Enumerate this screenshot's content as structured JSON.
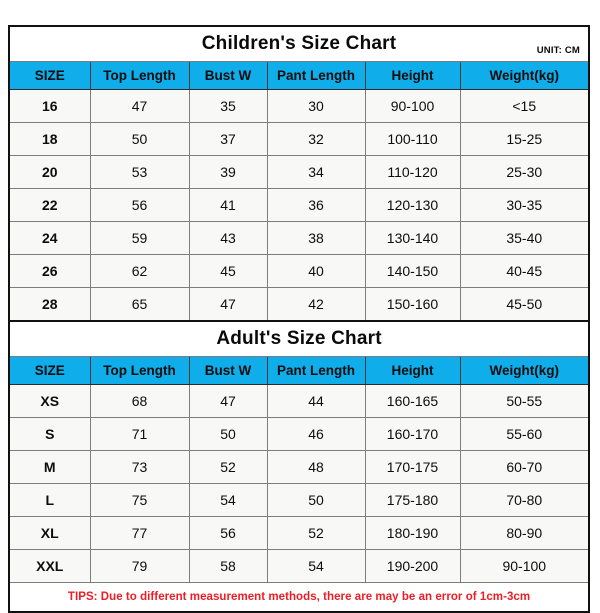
{
  "columns": [
    "SIZE",
    "Top Length",
    "Bust W",
    "Pant Length",
    "Height",
    "Weight(kg)"
  ],
  "colors": {
    "header_blue": "#0FADEA",
    "tips_red": "#EE1C24",
    "cell_background": "#F8F9F6",
    "border": "#7D7D7D",
    "outer_border": "#111111"
  },
  "children": {
    "title": "Children's Size Chart",
    "unit": "UNIT: CM",
    "headers": [
      "SIZE",
      "Top Length",
      "Bust W",
      "Pant Length",
      "Height",
      "Weight(kg)"
    ],
    "rows": [
      {
        "size": "16",
        "top_length": "47",
        "bust_w": "35",
        "pant_length": "30",
        "height": "90-100",
        "weight": "<15"
      },
      {
        "size": "18",
        "top_length": "50",
        "bust_w": "37",
        "pant_length": "32",
        "height": "100-110",
        "weight": "15-25"
      },
      {
        "size": "20",
        "top_length": "53",
        "bust_w": "39",
        "pant_length": "34",
        "height": "110-120",
        "weight": "25-30"
      },
      {
        "size": "22",
        "top_length": "56",
        "bust_w": "41",
        "pant_length": "36",
        "height": "120-130",
        "weight": "30-35"
      },
      {
        "size": "24",
        "top_length": "59",
        "bust_w": "43",
        "pant_length": "38",
        "height": "130-140",
        "weight": "35-40"
      },
      {
        "size": "26",
        "top_length": "62",
        "bust_w": "45",
        "pant_length": "40",
        "height": "140-150",
        "weight": "40-45"
      },
      {
        "size": "28",
        "top_length": "65",
        "bust_w": "47",
        "pant_length": "42",
        "height": "150-160",
        "weight": "45-50"
      }
    ]
  },
  "adult": {
    "title": "Adult's Size Chart",
    "headers": [
      "SIZE",
      "Top Length",
      "Bust W",
      "Pant Length",
      "Height",
      "Weight(kg)"
    ],
    "rows": [
      {
        "size": "XS",
        "top_length": "68",
        "bust_w": "47",
        "pant_length": "44",
        "height": "160-165",
        "weight": "50-55"
      },
      {
        "size": "S",
        "top_length": "71",
        "bust_w": "50",
        "pant_length": "46",
        "height": "160-170",
        "weight": "55-60"
      },
      {
        "size": "M",
        "top_length": "73",
        "bust_w": "52",
        "pant_length": "48",
        "height": "170-175",
        "weight": "60-70"
      },
      {
        "size": "L",
        "top_length": "75",
        "bust_w": "54",
        "pant_length": "50",
        "height": "175-180",
        "weight": "70-80"
      },
      {
        "size": "XL",
        "top_length": "77",
        "bust_w": "56",
        "pant_length": "52",
        "height": "180-190",
        "weight": "80-90"
      },
      {
        "size": "XXL",
        "top_length": "79",
        "bust_w": "58",
        "pant_length": "54",
        "height": "190-200",
        "weight": "90-100"
      }
    ],
    "tips": "TIPS: Due to different measurement methods, there are may be an error of 1cm-3cm"
  }
}
